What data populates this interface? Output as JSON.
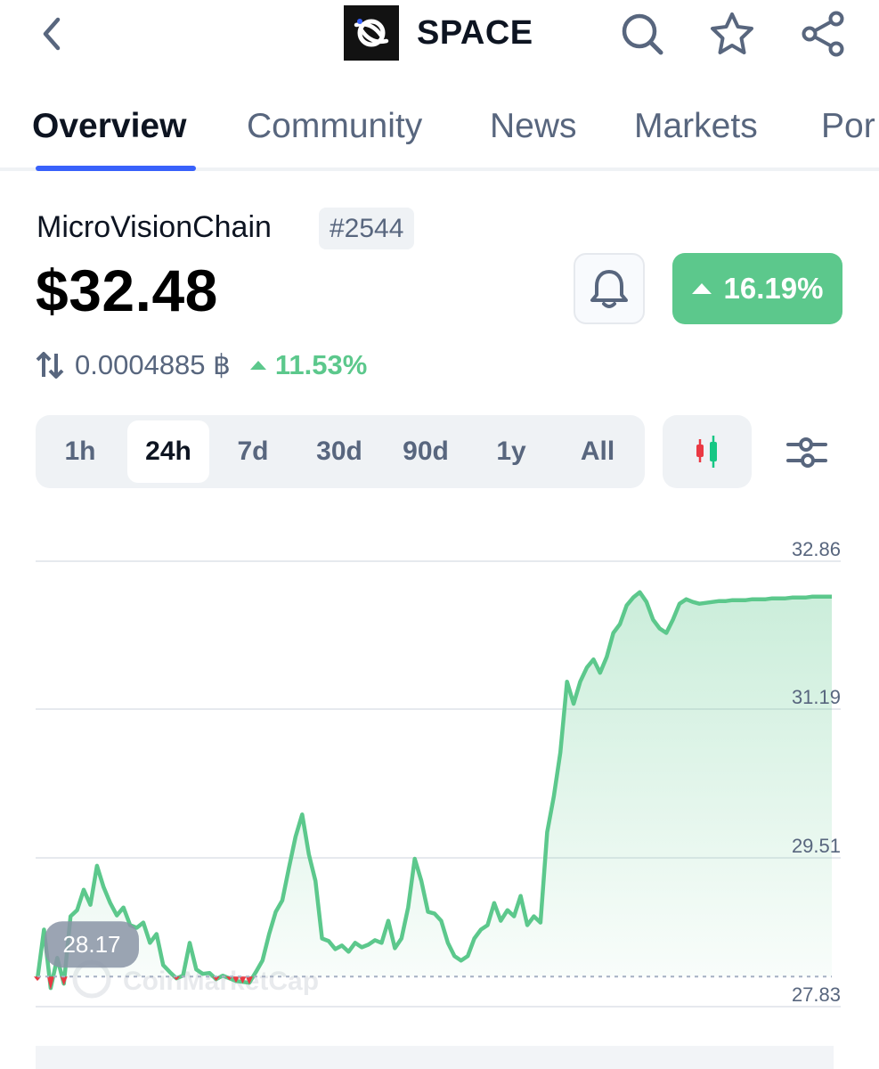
{
  "header": {
    "title": "SPACE",
    "icons": [
      "back-icon",
      "search-icon",
      "star-icon",
      "share-icon"
    ]
  },
  "tabs": [
    {
      "label": "Overview",
      "active": true
    },
    {
      "label": "Community",
      "active": false
    },
    {
      "label": "News",
      "active": false
    },
    {
      "label": "Markets",
      "active": false
    },
    {
      "label": "Por",
      "active": false
    }
  ],
  "coin": {
    "name": "MicroVisionChain",
    "rank": "#2544",
    "price": "$32.48",
    "change_24h": "16.19%",
    "btc_price": "0.0004885 ฿",
    "btc_change": "11.53%"
  },
  "ranges": [
    {
      "label": "1h",
      "active": false
    },
    {
      "label": "24h",
      "active": true
    },
    {
      "label": "7d",
      "active": false
    },
    {
      "label": "30d",
      "active": false
    },
    {
      "label": "90d",
      "active": false
    },
    {
      "label": "1y",
      "active": false
    },
    {
      "label": "All",
      "active": false
    }
  ],
  "colors": {
    "up": "#5cc88c",
    "down": "#ea3943",
    "accent": "#3861fb",
    "text_secondary": "#58667e"
  },
  "chart_data": {
    "type": "area",
    "y_ticks": [
      "32.86",
      "31.19",
      "29.51",
      "27.83"
    ],
    "ylim": [
      27.83,
      32.86
    ],
    "baseline": 28.17,
    "baseline_label": "28.17",
    "watermark": "CoinMarketCap",
    "grid": true,
    "x": [
      0,
      1,
      2,
      3,
      4,
      5,
      6,
      7,
      8,
      9,
      10,
      11,
      12,
      13,
      14,
      15,
      16,
      17,
      18,
      19,
      20,
      21,
      22,
      23,
      24,
      25,
      26,
      27,
      28,
      29,
      30,
      31,
      32,
      33,
      34,
      35,
      36,
      37,
      38,
      39,
      40,
      41,
      42,
      43,
      44,
      45,
      46,
      47,
      48,
      49,
      50,
      51,
      52,
      53,
      54,
      55,
      56,
      57,
      58,
      59,
      60,
      61,
      62,
      63,
      64,
      65,
      66,
      67,
      68,
      69,
      70,
      71,
      72,
      73,
      74,
      75,
      76,
      77,
      78,
      79,
      80,
      81,
      82,
      83,
      84,
      85,
      86,
      87,
      88,
      89,
      90,
      91,
      92,
      93,
      94,
      95,
      96,
      97,
      98,
      99,
      100,
      101,
      102,
      103,
      104,
      105,
      106,
      107,
      108,
      109,
      110,
      111,
      112,
      113,
      114,
      115,
      116,
      117,
      118,
      119,
      120
    ],
    "values": [
      28.14,
      28.7,
      28.04,
      28.38,
      28.09,
      28.85,
      28.92,
      29.15,
      28.98,
      29.42,
      29.18,
      29.0,
      28.86,
      28.95,
      28.75,
      28.72,
      28.78,
      28.55,
      28.65,
      28.3,
      28.22,
      28.15,
      28.18,
      28.55,
      28.25,
      28.2,
      28.21,
      28.14,
      28.18,
      28.15,
      28.12,
      28.11,
      28.1,
      28.22,
      28.35,
      28.65,
      28.9,
      29.03,
      29.4,
      29.75,
      30.0,
      29.55,
      29.25,
      28.6,
      28.57,
      28.48,
      28.52,
      28.45,
      28.55,
      28.5,
      28.53,
      28.58,
      28.55,
      28.8,
      28.49,
      28.6,
      28.95,
      29.5,
      29.25,
      28.9,
      28.88,
      28.8,
      28.55,
      28.4,
      28.35,
      28.4,
      28.6,
      28.7,
      28.75,
      29.0,
      28.8,
      28.92,
      28.85,
      29.08,
      28.75,
      28.85,
      28.78,
      29.8,
      30.2,
      30.7,
      31.5,
      31.25,
      31.5,
      31.66,
      31.75,
      31.6,
      31.78,
      32.05,
      32.15,
      32.36,
      32.45,
      32.51,
      32.4,
      32.2,
      32.1,
      32.05,
      32.2,
      32.38,
      32.43,
      32.4,
      32.38,
      32.39,
      32.4,
      32.41,
      32.41,
      32.42,
      32.42,
      32.42,
      32.43,
      32.43,
      32.43,
      32.44,
      32.44,
      32.44,
      32.45,
      32.45,
      32.45,
      32.46,
      32.46,
      32.46,
      32.46
    ],
    "series_color_up": "#5cc88c",
    "series_color_down": "#ea3943"
  }
}
